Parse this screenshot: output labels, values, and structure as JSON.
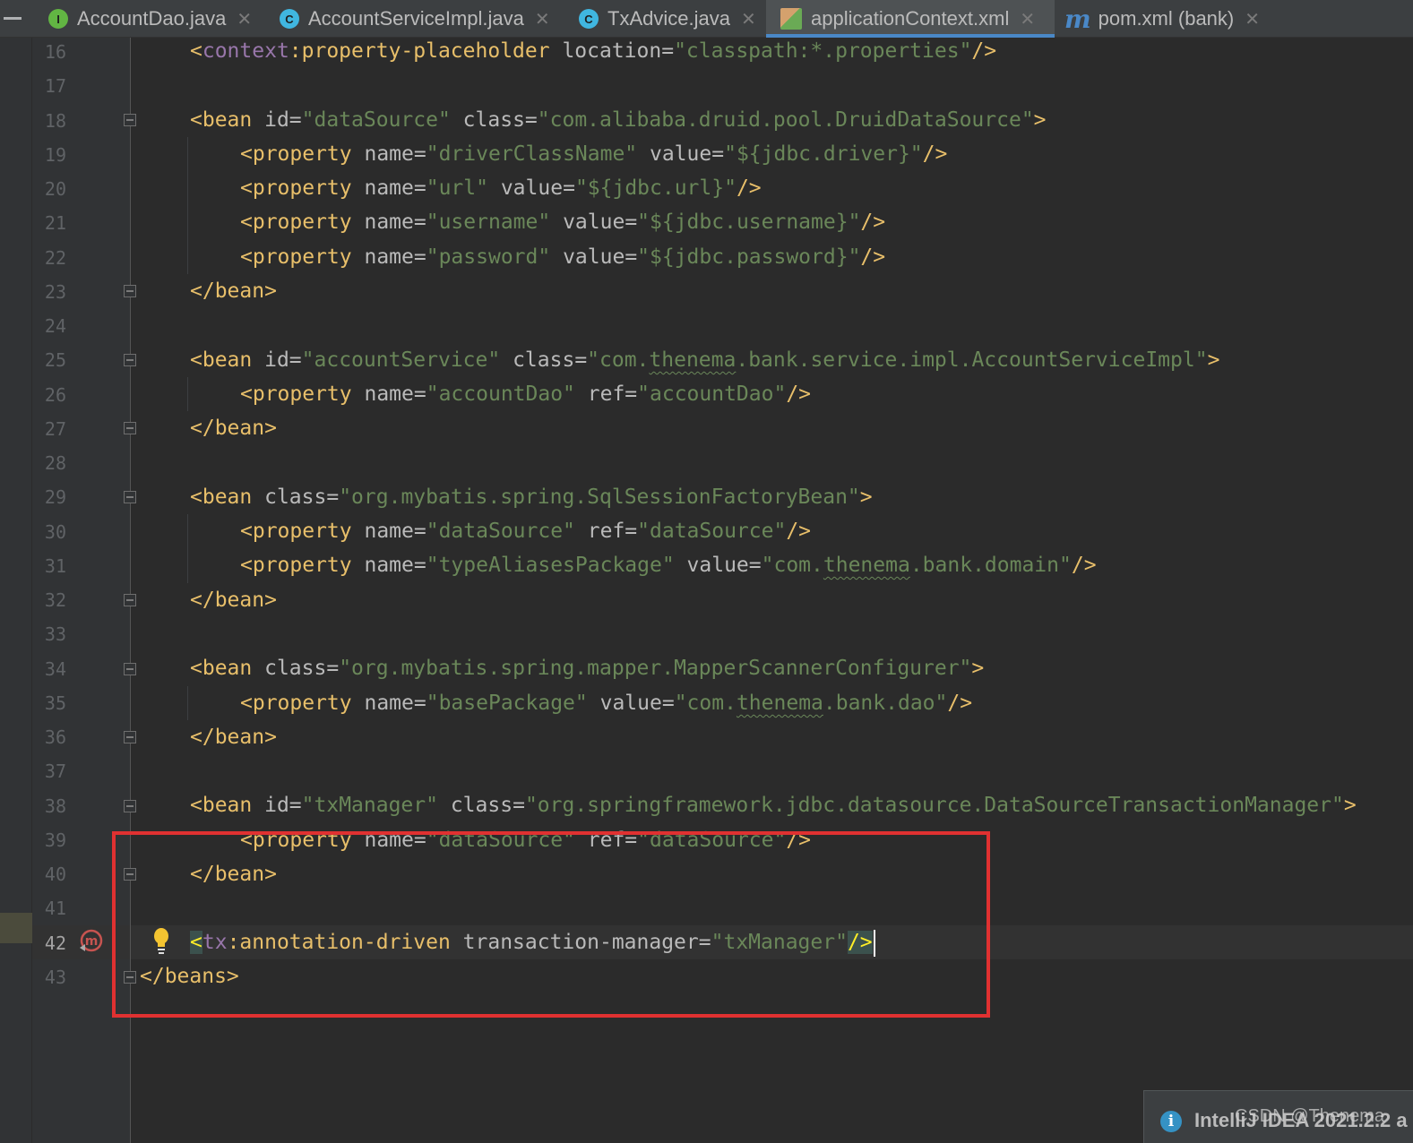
{
  "tabs": [
    {
      "icon": "interface-icon",
      "glyph": "I",
      "label": "AccountDao.java",
      "close": "✕"
    },
    {
      "icon": "class-icon",
      "glyph": "C",
      "label": "AccountServiceImpl.java",
      "close": "✕"
    },
    {
      "icon": "class-icon",
      "glyph": "C",
      "label": "TxAdvice.java",
      "close": "✕"
    },
    {
      "icon": "xml-icon",
      "glyph": "",
      "label": "applicationContext.xml",
      "close": "✕"
    },
    {
      "icon": "maven-icon",
      "glyph": "m",
      "label": "pom.xml (bank)",
      "close": "✕"
    }
  ],
  "active_tab": "applicationContext.xml",
  "line_numbers": [
    "16",
    "17",
    "18",
    "19",
    "20",
    "21",
    "22",
    "23",
    "24",
    "25",
    "26",
    "27",
    "28",
    "29",
    "30",
    "31",
    "32",
    "33",
    "34",
    "35",
    "36",
    "37",
    "38",
    "39",
    "40",
    "41",
    "42",
    "43"
  ],
  "current_line": "42",
  "code": {
    "l16": [
      "<",
      "context",
      ":property-placeholder",
      " location",
      "=",
      "\"classpath:*.properties\"",
      "/>"
    ],
    "l18": [
      "<bean",
      " id",
      "=",
      "\"dataSource\"",
      " class",
      "=",
      "\"com.alibaba.druid.pool.DruidDataSource\"",
      ">"
    ],
    "l19": [
      "<property",
      " name",
      "=",
      "\"driverClassName\"",
      " value",
      "=",
      "\"${jdbc.driver}\"",
      "/>"
    ],
    "l20": [
      "<property",
      " name",
      "=",
      "\"url\"",
      " value",
      "=",
      "\"${jdbc.url}\"",
      "/>"
    ],
    "l21": [
      "<property",
      " name",
      "=",
      "\"username\"",
      " value",
      "=",
      "\"${jdbc.username}\"",
      "/>"
    ],
    "l22": [
      "<property",
      " name",
      "=",
      "\"password\"",
      " value",
      "=",
      "\"${jdbc.password}\"",
      "/>"
    ],
    "l23": [
      "</bean>"
    ],
    "l25": [
      "<bean",
      " id",
      "=",
      "\"accountService\"",
      " class",
      "=",
      "\"com.",
      "thenema",
      ".bank.service.impl.AccountServiceImpl\"",
      ">"
    ],
    "l26": [
      "<property",
      " name",
      "=",
      "\"accountDao\"",
      " ref",
      "=",
      "\"accountDao\"",
      "/>"
    ],
    "l27": [
      "</bean>"
    ],
    "l29": [
      "<bean",
      " class",
      "=",
      "\"org.mybatis.spring.SqlSessionFactoryBean\"",
      ">"
    ],
    "l30": [
      "<property",
      " name",
      "=",
      "\"dataSource\"",
      " ref",
      "=",
      "\"dataSource\"",
      "/>"
    ],
    "l31": [
      "<property",
      " name",
      "=",
      "\"typeAliasesPackage\"",
      " value",
      "=",
      "\"com.",
      "thenema",
      ".bank.domain\"",
      "/>"
    ],
    "l32": [
      "</bean>"
    ],
    "l34": [
      "<bean",
      " class",
      "=",
      "\"org.mybatis.spring.mapper.MapperScannerConfigurer\"",
      ">"
    ],
    "l35": [
      "<property",
      " name",
      "=",
      "\"basePackage\"",
      " value",
      "=",
      "\"com.",
      "thenema",
      ".bank.dao\"",
      "/>"
    ],
    "l36": [
      "</bean>"
    ],
    "l38": [
      "<bean",
      " id",
      "=",
      "\"txManager\"",
      " class",
      "=",
      "\"org.springframework.jdbc.datasource.DataSourceTransactionManager\"",
      ">"
    ],
    "l39": [
      "<property",
      " name",
      "=",
      "\"dataSource\"",
      " ref",
      "=",
      "\"dataSource\"",
      "/>"
    ],
    "l40": [
      "</bean>"
    ],
    "l42": [
      "<",
      "tx",
      ":annotation-driven",
      " transaction-manager",
      "=",
      "\"txManager\"",
      "/>"
    ],
    "l43": [
      "</beans>"
    ]
  },
  "notification": {
    "icon": "info-icon",
    "glyph": "i",
    "text": "IntelliJ IDEA 2021.2.2 a"
  },
  "watermark": "CSDN @Thenema",
  "colors": {
    "tag": "#e8bf6a",
    "attr": "#bababa",
    "value": "#6a8759",
    "namespace": "#9876aa",
    "highlight_box": "#e03131",
    "active_tab_underline": "#4a88c7"
  }
}
